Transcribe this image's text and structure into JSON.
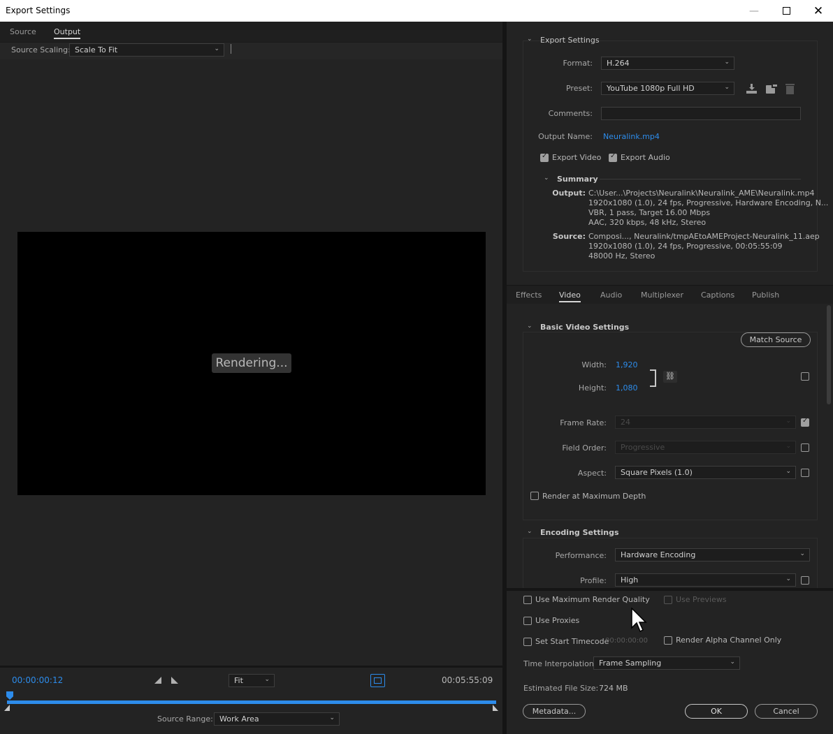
{
  "window": {
    "title": "Export Settings",
    "minimize_icon": "minimize-icon",
    "maximize_icon": "maximize-icon",
    "close_icon": "close-icon"
  },
  "left": {
    "tabs": [
      {
        "label": "Source",
        "active": false
      },
      {
        "label": "Output",
        "active": true
      }
    ],
    "source_scaling_label": "Source Scaling:",
    "source_scaling_value": "Scale To Fit",
    "rendering_text": "Rendering...",
    "current_timecode": "00:00:00:12",
    "end_timecode": "00:05:55:09",
    "zoom_value": "Fit",
    "source_range_label": "Source Range:",
    "source_range_value": "Work Area",
    "playhead_progress": 0.0
  },
  "export_settings": {
    "section_title": "Export Settings",
    "format_label": "Format:",
    "format_value": "H.264",
    "preset_label": "Preset:",
    "preset_value": "YouTube 1080p Full HD",
    "comments_label": "Comments:",
    "comments_value": "",
    "output_name_label": "Output Name:",
    "output_name_value": "Neuralink.mp4",
    "export_video_label": "Export Video",
    "export_video_checked": true,
    "export_audio_label": "Export Audio",
    "export_audio_checked": true,
    "summary_title": "Summary",
    "summary_output_label": "Output:",
    "summary_output_lines": [
      "C:\\User...\\Projects\\Neuralink\\Neuralink_AME\\Neuralink.mp4",
      "1920x1080 (1.0), 24 fps, Progressive, Hardware Encoding, N...",
      "VBR, 1 pass, Target 16.00 Mbps",
      "AAC, 320 kbps, 48 kHz, Stereo"
    ],
    "summary_source_label": "Source:",
    "summary_source_lines": [
      "Composi..., Neuralink/tmpAEtoAMEProject-Neuralink_11.aep",
      "1920x1080 (1.0), 24 fps, Progressive, 00:05:55:09",
      "48000 Hz, Stereo"
    ]
  },
  "settings_tabs": [
    {
      "label": "Effects",
      "active": false
    },
    {
      "label": "Video",
      "active": true
    },
    {
      "label": "Audio",
      "active": false
    },
    {
      "label": "Multiplexer",
      "active": false
    },
    {
      "label": "Captions",
      "active": false
    },
    {
      "label": "Publish",
      "active": false
    }
  ],
  "basic_video": {
    "section_title": "Basic Video Settings",
    "match_source_label": "Match Source",
    "width_label": "Width:",
    "width_value": "1,920",
    "height_label": "Height:",
    "height_value": "1,080",
    "frame_rate_label": "Frame Rate:",
    "frame_rate_value": "24",
    "field_order_label": "Field Order:",
    "field_order_value": "Progressive",
    "aspect_label": "Aspect:",
    "aspect_value": "Square Pixels (1.0)",
    "render_max_depth_label": "Render at Maximum Depth"
  },
  "encoding": {
    "section_title": "Encoding Settings",
    "performance_label": "Performance:",
    "performance_value": "Hardware Encoding",
    "profile_label": "Profile:",
    "profile_value": "High"
  },
  "bottom": {
    "use_max_render_quality": "Use Maximum Render Quality",
    "use_previews": "Use Previews",
    "use_proxies": "Use Proxies",
    "set_start_timecode": "Set Start Timecode",
    "start_timecode_value": "00:00:00:00",
    "render_alpha_only": "Render Alpha Channel Only",
    "time_interpolation_label": "Time Interpolation:",
    "time_interpolation_value": "Frame Sampling",
    "estimated_size_label": "Estimated File Size:",
    "estimated_size_value": "724 MB",
    "metadata_label": "Metadata...",
    "ok_label": "OK",
    "cancel_label": "Cancel"
  }
}
